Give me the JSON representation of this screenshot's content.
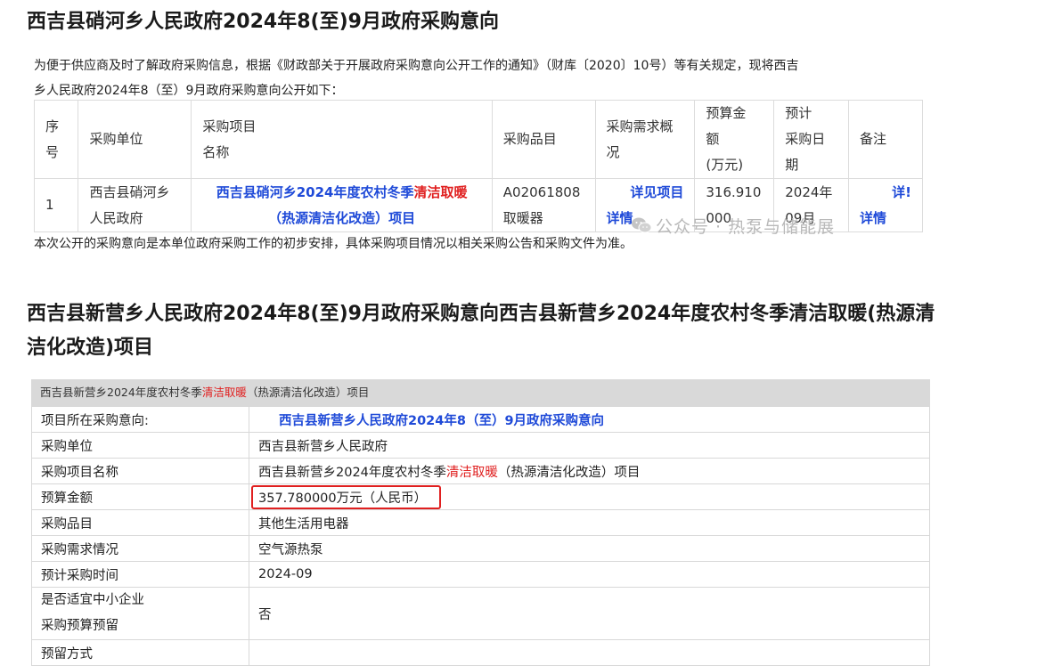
{
  "section1": {
    "title": "西吉县硝河乡人民政府2024年8(至)9月政府采购意向",
    "intro_line1": "为便于供应商及时了解政府采购信息，根据《财政部关于开展政府采购意向公开工作的通知》（财库〔2020〕10号）等有关规定，现将西吉",
    "intro_line2": "乡人民政府2024年8（至）9月政府采购意向公开如下：",
    "headers": {
      "seq_a": "序",
      "seq_b": "号",
      "unit": "采购单位",
      "project_a": "采购项目",
      "project_b": "名称",
      "item": "采购品目",
      "demand_a": "采购需求概",
      "demand_b": "况",
      "budget_a": "预算金",
      "budget_b": "额",
      "budget_c": "(万元)",
      "date_a": "预计",
      "date_b": "采购日",
      "date_c": "期",
      "remark": "备注"
    },
    "row": {
      "seq": "1",
      "unit_a": "西吉县硝河乡",
      "unit_b": "人民政府",
      "project_a_pre": "西吉县硝河乡2024年度农村冬季",
      "project_a_hl": "清洁取暖",
      "project_b": "（热源清洁化改造）项目",
      "item_a": "A02061808",
      "item_b": "取暖器",
      "demand_a": "详见项目",
      "demand_b": "详情",
      "budget_a": "316.910",
      "budget_b": "000",
      "date_a": "2024年",
      "date_b": "09月",
      "remark_a": "详!",
      "remark_b": "详情"
    },
    "note": "本次公开的采购意向是本单位政府采购工作的初步安排，具体采购项目情况以相关采购公告和采购文件为准。",
    "watermark": "公众号 · 热泵与储能展"
  },
  "section2": {
    "title": "西吉县新营乡人民政府2024年8(至)9月政府采购意向西吉县新营乡2024年度农村冬季清洁取暖(热源清洁化改造)项目",
    "header_pre": "西吉县新营乡2024年度农村冬季",
    "header_hl": "清洁取暖",
    "header_post": "（热源清洁化改造）项目",
    "rows": {
      "intent_label": "项目所在采购意向:",
      "intent_value": "西吉县新营乡人民政府2024年8（至）9月政府采购意向",
      "unit_label": "采购单位",
      "unit_value": "西吉县新营乡人民政府",
      "name_label": "采购项目名称",
      "name_value_pre": "西吉县新营乡2024年度农村冬季",
      "name_value_hl": "清洁取暖",
      "name_value_post": "（热源清洁化改造）项目",
      "budget_label": "预算金额",
      "budget_value": "357.780000万元（人民币）",
      "item_label": "采购品目",
      "item_value": "其他生活用电器",
      "demand_label": "采购需求情况",
      "demand_value": "空气源热泵",
      "time_label": "预计采购时间",
      "time_value": "2024-09",
      "sme_label_a": "是否适宜中小企业",
      "sme_label_b": "采购预算预留",
      "sme_value": "否",
      "reserve_label": "预留方式",
      "reserve_value": ""
    }
  }
}
